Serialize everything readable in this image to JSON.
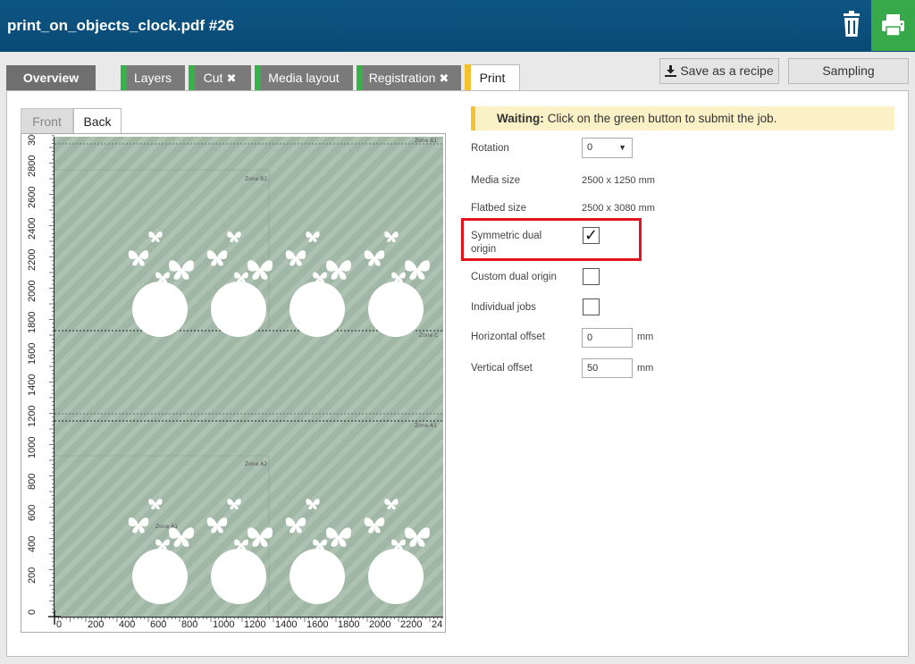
{
  "app": {
    "title": "print_on_objects_clock.pdf #26"
  },
  "tabs": [
    {
      "label": "Overview",
      "state": "default"
    },
    {
      "label": "Layers",
      "state": "done"
    },
    {
      "label": "Cut",
      "state": "done",
      "closable": true
    },
    {
      "label": "Media layout",
      "state": "done"
    },
    {
      "label": "Registration",
      "state": "done",
      "closable": true
    },
    {
      "label": "Print",
      "state": "active"
    }
  ],
  "tab_close_glyph": "✖",
  "toolbar": {
    "save_recipe_label": "Save as a recipe",
    "sampling_label": "Sampling"
  },
  "preview": {
    "tabs": [
      "Front",
      "Back"
    ],
    "active_tab": "Back",
    "zones": [
      "Zone B1",
      "Zone B2",
      "Zone C",
      "Zone A1",
      "Zone A2",
      "Zone A1"
    ],
    "x_ticks": [
      "0",
      "200",
      "400",
      "600",
      "800",
      "1000",
      "1200",
      "1400",
      "1600",
      "1800",
      "2000",
      "2200",
      "24"
    ],
    "y_ticks": [
      "0",
      "200",
      "400",
      "600",
      "800",
      "1000",
      "1200",
      "1400",
      "1600",
      "1800",
      "2000",
      "2200",
      "2400",
      "2600",
      "2800",
      "3000"
    ]
  },
  "form": {
    "status_title": "Waiting:",
    "status_message": "Click on the green button to submit the job.",
    "rotation_label": "Rotation",
    "rotation_value": "0",
    "media_size_label": "Media size",
    "media_size_value": "2500 x 1250 mm",
    "flatbed_size_label": "Flatbed size",
    "flatbed_size_value": "2500 x 3080 mm",
    "symmetric_dual_origin_label": "Symmetric dual origin",
    "symmetric_dual_origin_checked": true,
    "custom_dual_origin_label": "Custom dual origin",
    "custom_dual_origin_checked": false,
    "individual_jobs_label": "Individual jobs",
    "individual_jobs_checked": false,
    "horizontal_offset_label": "Horizontal offset",
    "horizontal_offset_value": "0",
    "vertical_offset_label": "Vertical offset",
    "vertical_offset_value": "50",
    "unit": "mm"
  },
  "colors": {
    "header": "#0a4a75",
    "print_button": "#38a94a",
    "tab_done_bar": "#37b24a",
    "tab_active_bar": "#f2c230",
    "waiting_bg": "#fbf1c7",
    "highlight": "#e1141b",
    "preview_fill": "#9eb6a3"
  },
  "icons": {
    "trash": "trash-icon",
    "print": "printer-icon",
    "save": "download-icon",
    "select_caret": "chevron-down-icon",
    "checkmark": "check-icon"
  }
}
